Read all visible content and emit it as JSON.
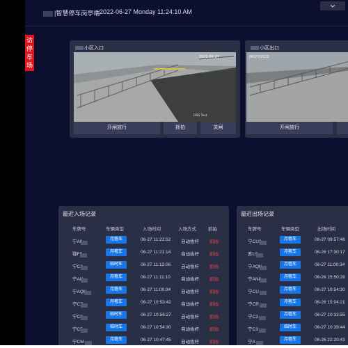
{
  "header": {
    "title": "|智慧停车岗亭端",
    "datetime": "2022-06-27 Monday 11:24:10 AM",
    "dropdown_icon": "chevron-down-icon"
  },
  "side_tab": {
    "label": "访\n停\n车\n场"
  },
  "cameras": [
    {
      "title": "小区入口",
      "overlay_time": "2022-06-27",
      "buttons": [
        "开闸放行",
        "抓拍",
        "关闸"
      ]
    },
    {
      "title": "小区出口",
      "overlay_time": "06/27/2022",
      "buttons": [
        "开闸放行"
      ]
    }
  ],
  "entry_records": {
    "title": "最近入场记录",
    "columns": [
      "车牌号",
      "车辆类型",
      "入场时间",
      "入场方式",
      "抓拍"
    ],
    "rows": [
      {
        "plate": "宁A",
        "plate_suffix": "8",
        "type": "月租车",
        "time": "06-27 11:22:52",
        "method": "自动抬杆",
        "status": "抓拍"
      },
      {
        "plate": "鄂F",
        "plate_suffix": "8",
        "type": "月租车",
        "time": "06-27 11:21:14",
        "method": "自动抬杆",
        "status": "抓拍"
      },
      {
        "plate": "宁C",
        "plate_suffix": "2",
        "type": "临时车",
        "time": "06-27 11:12:06",
        "method": "自动抬杆",
        "status": "抓拍"
      },
      {
        "plate": "宁A",
        "plate_suffix": "N",
        "type": "月租车",
        "time": "06-27 11:11:10",
        "method": "自动抬杆",
        "status": "抓拍"
      },
      {
        "plate": "宁AQ",
        "plate_suffix": "N",
        "type": "月租车",
        "time": "06-27 11:00:34",
        "method": "自动抬杆",
        "status": "抓拍"
      },
      {
        "plate": "宁C",
        "plate_suffix": "7",
        "type": "月租车",
        "time": "06-27 10:53:42",
        "method": "自动抬杆",
        "status": "抓拍"
      },
      {
        "plate": "宁C",
        "plate_suffix": "8",
        "type": "临时车",
        "time": "06-27 10:56:27",
        "method": "自动抬杆",
        "status": "抓拍"
      },
      {
        "plate": "宁C",
        "plate_suffix": "5",
        "type": "临时车",
        "time": "06-27 10:54:30",
        "method": "自动抬杆",
        "status": "抓拍"
      },
      {
        "plate": "宁CM",
        "plate_suffix": "",
        "type": "月租车",
        "time": "06-27 10:47:45",
        "method": "自动抬杆",
        "status": "抓拍"
      }
    ]
  },
  "exit_records": {
    "title": "最近出场记录",
    "columns": [
      "车牌号",
      "车辆类型",
      "出场时间"
    ],
    "rows": [
      {
        "plate": "宁CU",
        "plate_suffix": "3",
        "type": "月租车",
        "time": "06-27 09:57:46"
      },
      {
        "plate": "苏U",
        "plate_suffix": "1",
        "type": "月租车",
        "time": "06-26 17:30:17"
      },
      {
        "plate": "宁AQ",
        "plate_suffix": "N",
        "type": "月租车",
        "time": "06-27 11:00:34"
      },
      {
        "plate": "宁AN",
        "plate_suffix": "8",
        "type": "月租车",
        "time": "06-26 15:50:28"
      },
      {
        "plate": "宁CU",
        "plate_suffix": "",
        "type": "月租车",
        "time": "06-27 10:54:30"
      },
      {
        "plate": "宁CR",
        "plate_suffix": "",
        "type": "月租车",
        "time": "06-26 15:04:21"
      },
      {
        "plate": "宁C3",
        "plate_suffix": "",
        "type": "月租车",
        "time": "06-27 10:33:55"
      },
      {
        "plate": "宁C3",
        "plate_suffix": "",
        "type": "临时车",
        "time": "06-27 10:39:44"
      },
      {
        "plate": "宁A",
        "plate_suffix": "",
        "type": "月租车",
        "time": "06-26 22:20:43"
      }
    ]
  }
}
